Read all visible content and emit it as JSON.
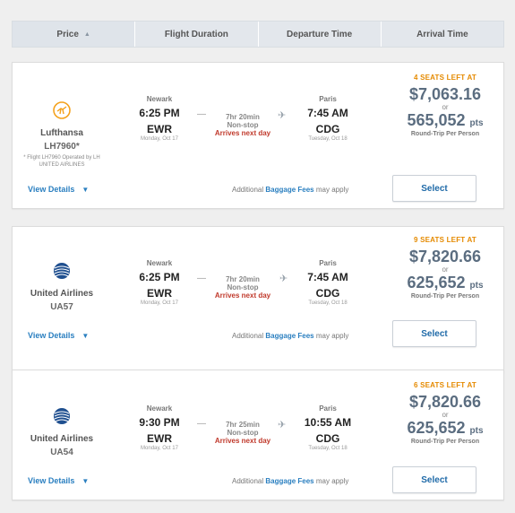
{
  "sort": {
    "columns": [
      {
        "label": "Price",
        "active": true
      },
      {
        "label": "Flight Duration"
      },
      {
        "label": "Departure Time"
      },
      {
        "label": "Arrival Time"
      }
    ],
    "arrow": "▲"
  },
  "colors": {
    "accent": "#2a7fc0",
    "seats": "#e58a00",
    "price": "#5b6d80",
    "nextday": "#c0392b"
  },
  "results": [
    {
      "airline": "Lufthansa",
      "logo_icon": "lufthansa-crane-icon",
      "flight": "LH7960*",
      "operated_note": "* Flight LH7960 Operated by LH UNITED AIRLINES",
      "depart_city": "Newark",
      "depart_time": "6:25 PM",
      "depart_code": "EWR",
      "depart_date": "Monday, Oct 17",
      "duration": "7hr 20min",
      "stops": "Non-stop",
      "next_day": "Arrives next day",
      "arrive_city": "Paris",
      "arrive_time": "7:45 AM",
      "arrive_code": "CDG",
      "arrive_date": "Tuesday, Oct 18",
      "seats_left": "4 SEATS LEFT AT",
      "price": "$7,063.16",
      "or": "or",
      "points": "565,052",
      "points_unit": "pts",
      "price_note": "Round-Trip Per Person",
      "view_details": "View Details",
      "baggage_prefix": "Additional",
      "baggage_link": "Baggage Fees",
      "baggage_suffix": "may apply",
      "select": "Select"
    },
    {
      "airline": "United Airlines",
      "logo_icon": "united-globe-icon",
      "flight": "UA57",
      "operated_note": "",
      "depart_city": "Newark",
      "depart_time": "6:25 PM",
      "depart_code": "EWR",
      "depart_date": "Monday, Oct 17",
      "duration": "7hr 20min",
      "stops": "Non-stop",
      "next_day": "Arrives next day",
      "arrive_city": "Paris",
      "arrive_time": "7:45 AM",
      "arrive_code": "CDG",
      "arrive_date": "Tuesday, Oct 18",
      "seats_left": "9 SEATS LEFT AT",
      "price": "$7,820.66",
      "or": "or",
      "points": "625,652",
      "points_unit": "pts",
      "price_note": "Round-Trip Per Person",
      "view_details": "View Details",
      "baggage_prefix": "Additional",
      "baggage_link": "Baggage Fees",
      "baggage_suffix": "may apply",
      "select": "Select"
    },
    {
      "airline": "United Airlines",
      "logo_icon": "united-globe-icon",
      "flight": "UA54",
      "operated_note": "",
      "depart_city": "Newark",
      "depart_time": "9:30 PM",
      "depart_code": "EWR",
      "depart_date": "Monday, Oct 17",
      "duration": "7hr 25min",
      "stops": "Non-stop",
      "next_day": "Arrives next day",
      "arrive_city": "Paris",
      "arrive_time": "10:55 AM",
      "arrive_code": "CDG",
      "arrive_date": "Tuesday, Oct 18",
      "seats_left": "6 SEATS LEFT AT",
      "price": "$7,820.66",
      "or": "or",
      "points": "625,652",
      "points_unit": "pts",
      "price_note": "Round-Trip Per Person",
      "view_details": "View Details",
      "baggage_prefix": "Additional",
      "baggage_link": "Baggage Fees",
      "baggage_suffix": "may apply",
      "select": "Select"
    }
  ]
}
